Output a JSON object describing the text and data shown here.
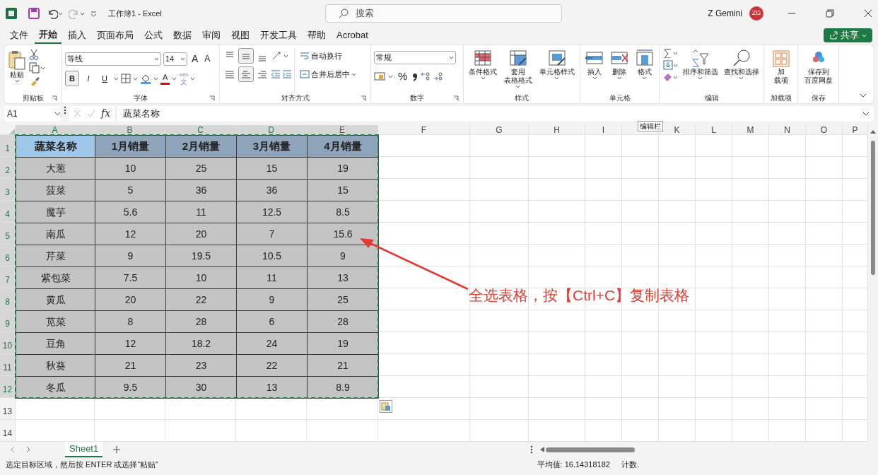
{
  "title_bar": {
    "title": "工作簿1 - Excel",
    "user": "Z Gemini",
    "avatar": "ZG"
  },
  "search": {
    "placeholder": "搜索"
  },
  "menu_tabs": [
    {
      "label": "文件",
      "selected": false
    },
    {
      "label": "开始",
      "selected": true
    },
    {
      "label": "插入",
      "selected": false
    },
    {
      "label": "页面布局",
      "selected": false
    },
    {
      "label": "公式",
      "selected": false
    },
    {
      "label": "数据",
      "selected": false
    },
    {
      "label": "审阅",
      "selected": false
    },
    {
      "label": "视图",
      "selected": false
    },
    {
      "label": "开发工具",
      "selected": false
    },
    {
      "label": "帮助",
      "selected": false
    },
    {
      "label": "Acrobat",
      "selected": false
    }
  ],
  "share_button": {
    "label": "共享"
  },
  "ribbon": {
    "clipboard": {
      "label": "剪贴板",
      "paste": "粘贴"
    },
    "font": {
      "label": "字体",
      "font_name": "等线",
      "font_size": "14",
      "grow": "A",
      "shrink": "A",
      "styles": [
        {
          "label": "B",
          "kind": "bold",
          "pressed": true
        },
        {
          "label": "I",
          "kind": "italic",
          "pressed": false
        },
        {
          "label": "U",
          "kind": "underline",
          "pressed": false
        }
      ],
      "font_color": "A",
      "phonetic_top": "wén",
      "phonetic_bottom": "文"
    },
    "alignment": {
      "label": "对齐方式",
      "wrap_text": "自动换行",
      "merge_center": "合并后居中",
      "vertical": [
        {
          "kind": "top",
          "pressed": false
        },
        {
          "kind": "middle",
          "pressed": true
        },
        {
          "kind": "bottom",
          "pressed": false
        }
      ],
      "horizontal": [
        {
          "kind": "left",
          "pressed": false
        },
        {
          "kind": "center",
          "pressed": true
        },
        {
          "kind": "right",
          "pressed": false
        }
      ]
    },
    "number": {
      "label": "数字",
      "format": "常规",
      "percent": "%"
    },
    "styles": {
      "label": "样式",
      "buttons": [
        {
          "kind": "conditional",
          "lines": [
            "条件格式"
          ]
        },
        {
          "kind": "table",
          "lines": [
            "套用",
            "表格格式"
          ]
        },
        {
          "kind": "cellstyle",
          "lines": [
            "单元格样式"
          ]
        }
      ]
    },
    "cells": {
      "label": "单元格",
      "buttons": [
        {
          "kind": "insert",
          "lines": [
            "插入"
          ]
        },
        {
          "kind": "delete",
          "lines": [
            "删除"
          ]
        },
        {
          "kind": "format",
          "lines": [
            "格式"
          ]
        }
      ]
    },
    "editing": {
      "label": "编辑",
      "buttons": [
        {
          "kind": "sort",
          "lines": [
            "排序和筛选"
          ]
        },
        {
          "kind": "find",
          "lines": [
            "查找和选择"
          ]
        }
      ]
    },
    "addins": {
      "label": "加载项",
      "buttons": [
        {
          "kind": "addins",
          "lines": [
            "加",
            "载项"
          ]
        }
      ]
    },
    "save": {
      "label": "保存",
      "buttons": [
        {
          "kind": "cloud",
          "lines": [
            "保存到",
            "百度网盘"
          ]
        }
      ]
    }
  },
  "formula_bar": {
    "name_box": "A1",
    "fx": "fx",
    "formula": "蔬菜名称"
  },
  "tooltip": "编辑栏",
  "sheet": {
    "columns": [
      {
        "label": "A",
        "selected": true
      },
      {
        "label": "B",
        "selected": true
      },
      {
        "label": "C",
        "selected": true
      },
      {
        "label": "D",
        "selected": true
      },
      {
        "label": "E",
        "selected": true
      },
      {
        "label": "F",
        "selected": false
      },
      {
        "label": "G",
        "selected": false
      },
      {
        "label": "H",
        "selected": false
      },
      {
        "label": "I",
        "selected": false
      },
      {
        "selected": false
      },
      {
        "label": "K",
        "selected": false
      },
      {
        "label": "L",
        "selected": false
      },
      {
        "label": "M",
        "selected": false
      },
      {
        "label": "N",
        "selected": false
      },
      {
        "label": "O",
        "selected": false
      },
      {
        "label": "P",
        "selected": false
      }
    ],
    "rows": [
      {
        "label": "1",
        "selected": true
      },
      {
        "label": "2",
        "selected": true
      },
      {
        "label": "3",
        "selected": true
      },
      {
        "label": "4",
        "selected": true
      },
      {
        "label": "5",
        "selected": true
      },
      {
        "label": "6",
        "selected": true
      },
      {
        "label": "7",
        "selected": true
      },
      {
        "label": "8",
        "selected": true
      },
      {
        "label": "9",
        "selected": true
      },
      {
        "label": "10",
        "selected": true
      },
      {
        "label": "11",
        "selected": true
      },
      {
        "label": "12",
        "selected": true
      },
      {
        "label": "13",
        "selected": false
      },
      {
        "label": "14",
        "selected": false
      }
    ],
    "table_header": [
      "蔬菜名称",
      "1月销量",
      "2月销量",
      "3月销量",
      "4月销量"
    ],
    "table_rows": [
      [
        "大葱",
        "10",
        "25",
        "15",
        "19"
      ],
      [
        "菠菜",
        "5",
        "36",
        "36",
        "15"
      ],
      [
        "魔芋",
        "5.6",
        "11",
        "12.5",
        "8.5"
      ],
      [
        "南瓜",
        "12",
        "20",
        "7",
        "15.6"
      ],
      [
        "芹菜",
        "9",
        "19.5",
        "10.5",
        "9"
      ],
      [
        "紫包菜",
        "7.5",
        "10",
        "11",
        "13"
      ],
      [
        "黄瓜",
        "20",
        "22",
        "9",
        "25"
      ],
      [
        "苋菜",
        "8",
        "28",
        "6",
        "28"
      ],
      [
        "豆角",
        "12",
        "18.2",
        "24",
        "19"
      ],
      [
        "秋葵",
        "21",
        "23",
        "22",
        "21"
      ],
      [
        "冬瓜",
        "9.5",
        "30",
        "13",
        "8.9"
      ]
    ]
  },
  "annotation": {
    "text": "全选表格，按【Ctrl+C】复制表格"
  },
  "sheet_tabs": [
    {
      "label": "Sheet1",
      "selected": true
    }
  ],
  "status_bar": {
    "message": "选定目标区域，然后按 ENTER 或选择“粘贴”",
    "average": "平均值: 16.14318182",
    "count": "计数."
  }
}
